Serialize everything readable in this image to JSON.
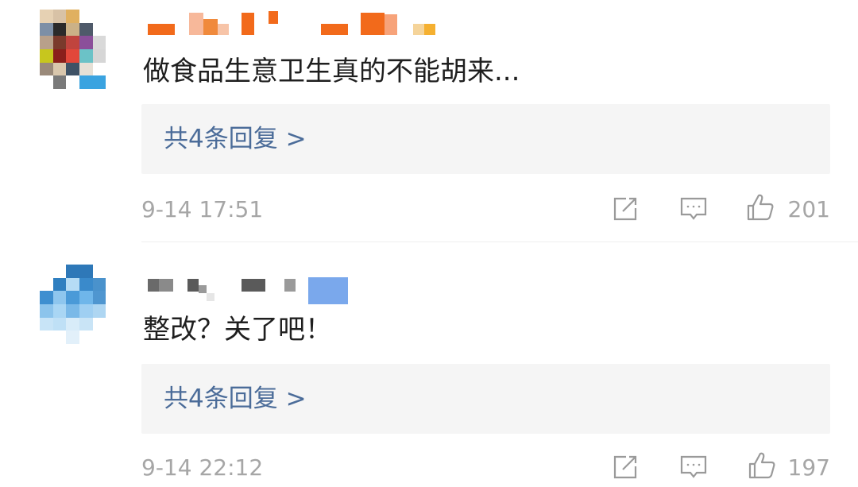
{
  "comments": [
    {
      "text": "做食品生意卫生真的不能胡来...",
      "reply_label": "共4条回复 >",
      "timestamp": "9-14 17:51",
      "likes": "201",
      "icons": [
        "repost-icon",
        "comment-icon",
        "like-icon"
      ]
    },
    {
      "text": "整改？关了吧！",
      "reply_label": "共4条回复 >",
      "timestamp": "9-14 22:12",
      "likes": "197",
      "icons": [
        "repost-icon",
        "comment-icon",
        "like-icon"
      ]
    }
  ],
  "colors": {
    "reply_link": "#4b6c99",
    "meta_text": "#a6a6a6",
    "reply_background": "#f5f5f5"
  }
}
